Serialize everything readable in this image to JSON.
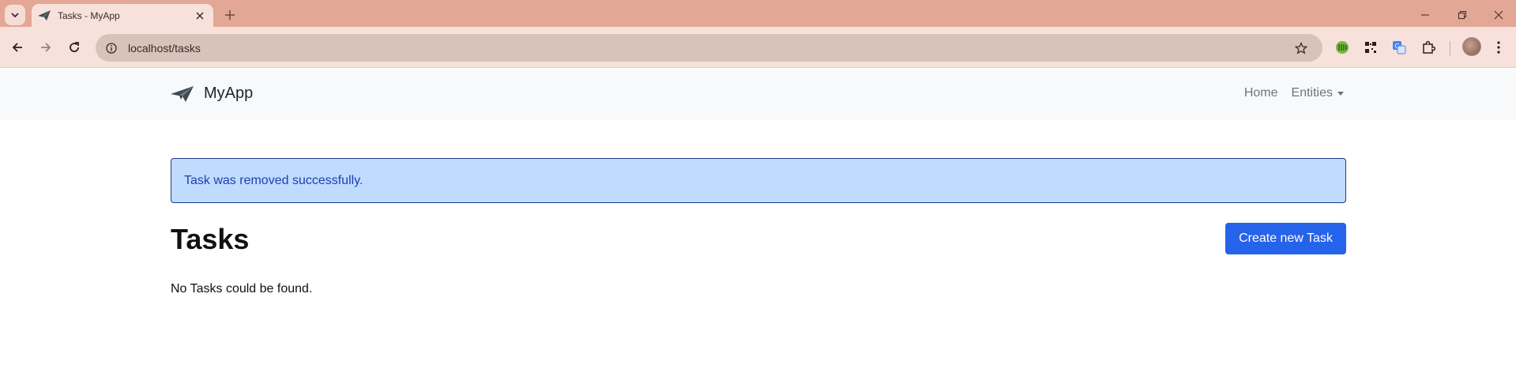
{
  "browser": {
    "tab": {
      "title": "Tasks - MyApp",
      "favicon": "paper-plane-icon"
    },
    "address_bar": {
      "url": "localhost/tasks"
    },
    "extensions": [
      "green-grid-extension-icon",
      "qr-code-icon",
      "google-translate-icon",
      "puzzle-extensions-icon"
    ]
  },
  "navbar": {
    "brand": {
      "icon": "paper-plane-icon",
      "text": "MyApp"
    },
    "links": {
      "home": "Home",
      "entities": "Entities"
    }
  },
  "alert": {
    "message": "Task was removed successfully.",
    "bg": "#bfdbfe",
    "text_color": "#1e40af"
  },
  "main": {
    "title": "Tasks",
    "create_button": "Create new Task",
    "empty_message": "No Tasks could be found."
  },
  "colors": {
    "primary": "#2563eb",
    "chrome": "#e3a796"
  }
}
